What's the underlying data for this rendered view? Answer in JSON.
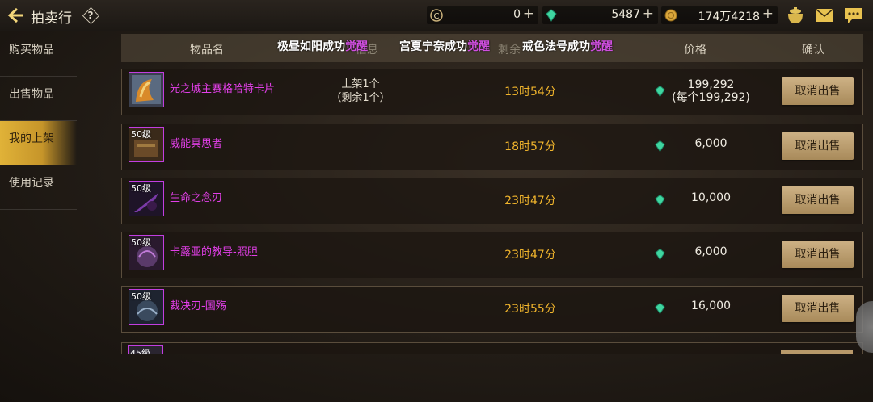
{
  "app": {
    "title": "拍卖行",
    "help_label": "?"
  },
  "currencies": [
    {
      "icon": "c-coin-icon",
      "value": "0",
      "plus": "+"
    },
    {
      "icon": "green-gem-icon",
      "value": "5487",
      "plus": "+"
    },
    {
      "icon": "gold-coin-icon",
      "value": "174万4218",
      "plus": "+"
    }
  ],
  "top_icons": [
    "treasure-pot-icon",
    "mail-icon",
    "chat-icon"
  ],
  "sidebar": {
    "items": [
      {
        "label": "购买物品",
        "active": false
      },
      {
        "label": "出售物品",
        "active": false
      },
      {
        "label": "我的上架",
        "active": true
      },
      {
        "label": "使用记录",
        "active": false
      }
    ]
  },
  "table_header": {
    "name": "物品名",
    "info": "信息",
    "remain": "剩余",
    "price": "价格",
    "confirm": "确认"
  },
  "notices": [
    {
      "text": "极昼如阳成功",
      "highlight": "觉醒"
    },
    {
      "text": "宫夏宁奈成功",
      "highlight": "觉醒"
    },
    {
      "text": "戒色法号成功",
      "highlight": "觉醒"
    }
  ],
  "listings": [
    {
      "level": "",
      "name": "光之城主赛格哈特卡片",
      "stock_line1": "上架1个",
      "stock_line2": "（剩余1个）",
      "time": "13时54分",
      "price": "199,292",
      "price_each": "(每个199,292)",
      "button": "取消出售"
    },
    {
      "level": "50级",
      "name": "威能冥思者",
      "stock_line1": "",
      "stock_line2": "",
      "time": "18时57分",
      "price": "6,000",
      "price_each": "",
      "button": "取消出售"
    },
    {
      "level": "50级",
      "name": "生命之念刃",
      "stock_line1": "",
      "stock_line2": "",
      "time": "23时47分",
      "price": "10,000",
      "price_each": "",
      "button": "取消出售"
    },
    {
      "level": "50级",
      "name": "卡露亚的教导-照胆",
      "stock_line1": "",
      "stock_line2": "",
      "time": "23时47分",
      "price": "6,000",
      "price_each": "",
      "button": "取消出售"
    },
    {
      "level": "50级",
      "name": "裁决刃-国殇",
      "stock_line1": "",
      "stock_line2": "",
      "time": "23时55分",
      "price": "16,000",
      "price_each": "",
      "button": "取消出售"
    }
  ],
  "partial_row": {
    "level": "45级"
  },
  "colors": {
    "accent_gold": "#e0b238",
    "item_name": "#e23fe8",
    "time": "#f0b42c",
    "button": "#b8996a"
  }
}
